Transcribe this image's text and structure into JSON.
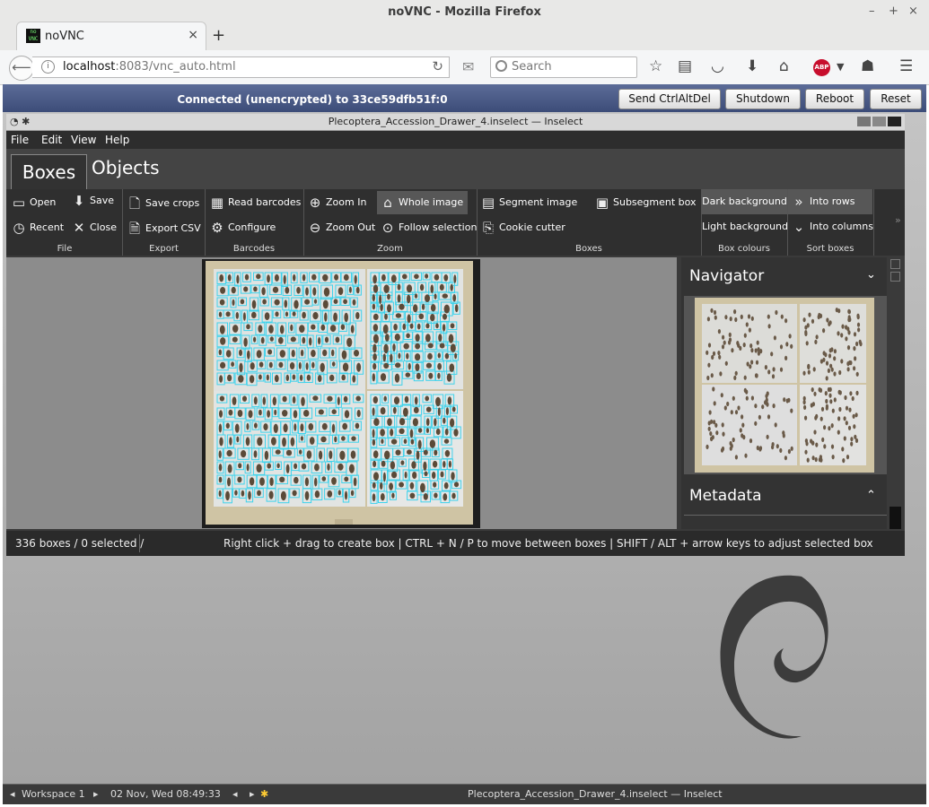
{
  "browser": {
    "window_title": "noVNC - Mozilla Firefox",
    "tab_label": "noVNC",
    "favicon_text": "noVNC",
    "url_host": "localhost",
    "url_rest": ":8083/vnc_auto.html",
    "search_placeholder": "Search",
    "abp_label": "ABP"
  },
  "novnc": {
    "status": "Connected (unencrypted) to 33ce59dfb51f:0",
    "buttons": [
      "Send CtrlAltDel",
      "Shutdown",
      "Reboot",
      "Reset"
    ]
  },
  "inselect": {
    "title": "Plecoptera_Accession_Drawer_4.inselect — Inselect",
    "menu": [
      "File",
      "Edit",
      "View",
      "Help"
    ],
    "tabs": [
      "Boxes",
      "Objects"
    ],
    "ribbon": {
      "open": "Open",
      "save": "Save",
      "recent": "Recent",
      "close": "Close",
      "save_crops": "Save crops",
      "export_csv": "Export CSV",
      "read_barcodes": "Read barcodes",
      "configure": "Configure",
      "zoom_in": "Zoom In",
      "zoom_out": "Zoom Out",
      "whole_image": "Whole image",
      "follow_selection": "Follow selection",
      "segment_image": "Segment image",
      "subsegment_box": "Subsegment box",
      "cookie_cutter": "Cookie cutter",
      "dark_background": "Dark background",
      "light_background": "Light background",
      "into_rows": "Into rows",
      "into_columns": "Into columns",
      "groups": [
        "File",
        "Export",
        "Barcodes",
        "Zoom",
        "Boxes",
        "Box colours",
        "Sort boxes"
      ]
    },
    "navigator_title": "Navigator",
    "metadata_title": "Metadata",
    "status_left": "336 boxes / 0 selected /",
    "status_right": "Right click + drag to create box  |  CTRL + N / P to move between boxes  |  SHIFT / ALT + arrow keys to adjust selected box"
  },
  "taskbar": {
    "workspace": "Workspace 1",
    "datetime": "02 Nov, Wed 08:49:33",
    "window": "Plecoptera_Accession_Drawer_4.inselect — Inselect"
  }
}
